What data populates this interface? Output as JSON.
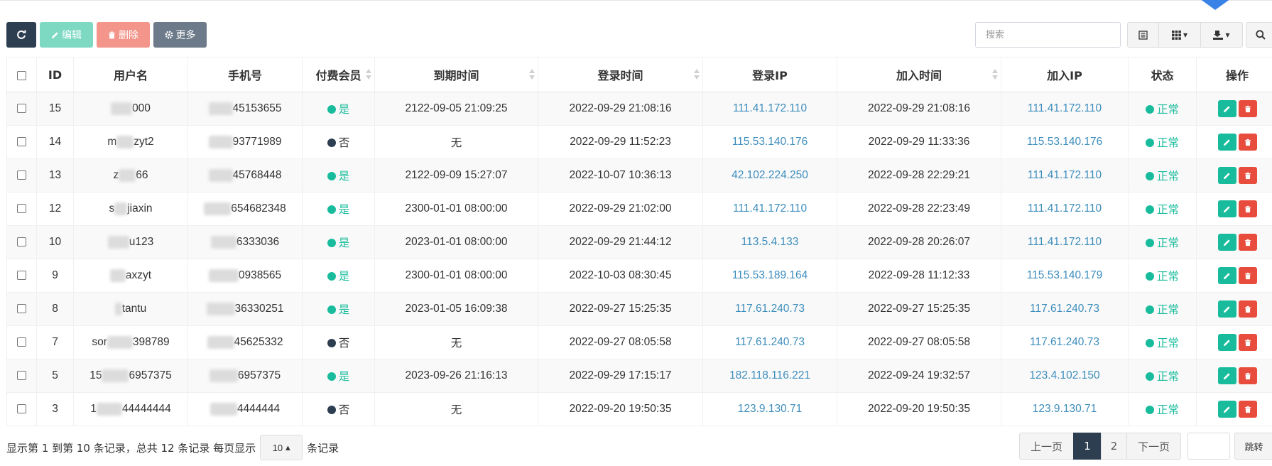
{
  "toolbar": {
    "refresh_icon": "refresh-icon",
    "edit_label": "编辑",
    "delete_label": "删除",
    "more_label": "更多",
    "search_placeholder": "搜索"
  },
  "columns": [
    "ID",
    "用户名",
    "手机号",
    "付费会员",
    "到期时间",
    "登录时间",
    "登录IP",
    "加入时间",
    "加入IP",
    "状态",
    "操作"
  ],
  "rows": [
    {
      "id": "15",
      "user_pre": "",
      "user_post": "000",
      "phone_post": "45153655",
      "paid": "是",
      "expire": "2122-09-05 21:09:25",
      "login_time": "2022-09-29 21:08:16",
      "login_ip": "111.41.172.110",
      "join_time": "2022-09-29 21:08:16",
      "join_ip": "111.41.172.110",
      "status": "正常"
    },
    {
      "id": "14",
      "user_pre": "m",
      "user_post": "zyt2",
      "phone_post": "93771989",
      "paid": "否",
      "expire": "无",
      "login_time": "2022-09-29 11:52:23",
      "login_ip": "115.53.140.176",
      "join_time": "2022-09-29 11:33:36",
      "join_ip": "115.53.140.176",
      "status": "正常"
    },
    {
      "id": "13",
      "user_pre": "z",
      "user_post": "66",
      "phone_post": "45768448",
      "paid": "是",
      "expire": "2122-09-09 15:27:07",
      "login_time": "2022-10-07 10:36:13",
      "login_ip": "42.102.224.250",
      "join_time": "2022-09-28 22:29:21",
      "join_ip": "111.41.172.110",
      "status": "正常"
    },
    {
      "id": "12",
      "user_pre": "s",
      "user_post": "jiaxin",
      "phone_post": "654682348",
      "paid": "是",
      "expire": "2300-01-01 08:00:00",
      "login_time": "2022-09-29 21:02:00",
      "login_ip": "111.41.172.110",
      "join_time": "2022-09-28 22:23:49",
      "join_ip": "111.41.172.110",
      "status": "正常"
    },
    {
      "id": "10",
      "user_pre": "",
      "user_post": "u123",
      "phone_post": "6333036",
      "paid": "是",
      "expire": "2023-01-01 08:00:00",
      "login_time": "2022-09-29 21:44:12",
      "login_ip": "113.5.4.133",
      "join_time": "2022-09-28 20:26:07",
      "join_ip": "111.41.172.110",
      "status": "正常"
    },
    {
      "id": "9",
      "user_pre": "",
      "user_post": "axzyt",
      "phone_post": "0938565",
      "paid": "是",
      "expire": "2300-01-01 08:00:00",
      "login_time": "2022-10-03 08:30:45",
      "login_ip": "115.53.189.164",
      "join_time": "2022-09-28 11:12:33",
      "join_ip": "115.53.140.179",
      "status": "正常"
    },
    {
      "id": "8",
      "user_pre": "",
      "user_post": "tantu",
      "phone_post": "36330251",
      "paid": "是",
      "expire": "2023-01-05 16:09:38",
      "login_time": "2022-09-27 15:25:35",
      "login_ip": "117.61.240.73",
      "join_time": "2022-09-27 15:25:35",
      "join_ip": "117.61.240.73",
      "status": "正常"
    },
    {
      "id": "7",
      "user_pre": "sor",
      "user_post": "398789",
      "phone_post": "45625332",
      "paid": "否",
      "expire": "无",
      "login_time": "2022-09-27 08:05:58",
      "login_ip": "117.61.240.73",
      "join_time": "2022-09-27 08:05:58",
      "join_ip": "117.61.240.73",
      "status": "正常"
    },
    {
      "id": "5",
      "user_pre": "15",
      "user_post": "6957375",
      "phone_post": "6957375",
      "paid": "是",
      "expire": "2023-09-26 21:16:13",
      "login_time": "2022-09-29 17:15:17",
      "login_ip": "182.118.116.221",
      "join_time": "2022-09-24 19:32:57",
      "join_ip": "123.4.102.150",
      "status": "正常"
    },
    {
      "id": "3",
      "user_pre": "1",
      "user_post": "44444444",
      "phone_post": "4444444",
      "paid": "否",
      "expire": "无",
      "login_time": "2022-09-20 19:50:35",
      "login_ip": "123.9.130.71",
      "join_time": "2022-09-20 19:50:35",
      "join_ip": "123.9.130.71",
      "status": "正常"
    }
  ],
  "footer": {
    "summary": "显示第 1 到第 10 条记录，总共 12 条记录 每页显示",
    "page_size": "10",
    "suffix": "条记录"
  },
  "pagination": {
    "prev": "上一页",
    "pages": [
      "1",
      "2"
    ],
    "next": "下一页",
    "jump": "跳转"
  },
  "colors": {
    "primary": "#2c3e50",
    "success": "#18bc9c",
    "danger": "#e74c3c",
    "link": "#3c8dbc"
  }
}
